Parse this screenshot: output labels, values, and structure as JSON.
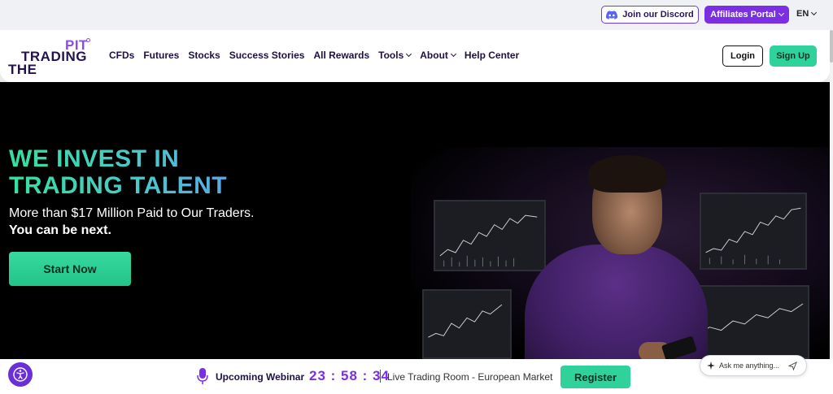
{
  "topbar": {
    "discord_label": "Join our Discord",
    "affiliates_label": "Affiliates Portal",
    "language": "EN"
  },
  "logo": {
    "line1": "PIT",
    "line2": "TRADING",
    "line3": "THE"
  },
  "nav": {
    "items": [
      {
        "label": "CFDs",
        "dropdown": false
      },
      {
        "label": "Futures",
        "dropdown": false
      },
      {
        "label": "Stocks",
        "dropdown": false
      },
      {
        "label": "Success Stories",
        "dropdown": false
      },
      {
        "label": "All Rewards",
        "dropdown": false
      },
      {
        "label": "Tools",
        "dropdown": true
      },
      {
        "label": "About",
        "dropdown": true
      },
      {
        "label": "Help Center",
        "dropdown": false
      }
    ],
    "login_label": "Login",
    "signup_label": "Sign Up"
  },
  "hero": {
    "title_line1": "WE INVEST IN",
    "title_line2": "TRADING TALENT",
    "subtitle": "More than $17 Million Paid to Our Traders.",
    "subtitle_bold": "You can be next.",
    "cta_label": "Start Now"
  },
  "webinar": {
    "label": "Upcoming Webinar",
    "timer": "23 : 58 : 34",
    "room": "Live Trading Room - European Market",
    "register_label": "Register"
  },
  "chat": {
    "placeholder": "Ask me anything..."
  },
  "colors": {
    "brand_purple": "#7b2fe3",
    "accent_green": "#2fd29a",
    "navy_text": "#24124f"
  },
  "icons": {
    "discord": "discord-icon",
    "accessibility": "accessibility-icon",
    "microphone": "microphone-icon",
    "sparkle": "sparkle-icon",
    "send": "send-icon"
  }
}
